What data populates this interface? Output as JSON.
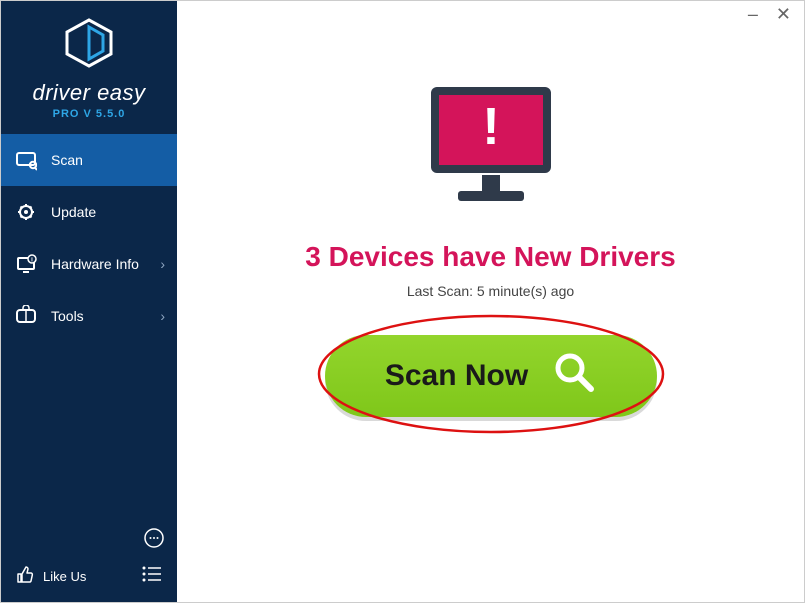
{
  "window": {
    "minimize": "–",
    "close": "✕"
  },
  "brand": {
    "name": "driver easy",
    "subtitle": "PRO V 5.5.0"
  },
  "sidebar": {
    "items": [
      {
        "label": "Scan",
        "icon": "scan-icon",
        "active": true,
        "hasSubmenu": false
      },
      {
        "label": "Update",
        "icon": "update-icon",
        "active": false,
        "hasSubmenu": false
      },
      {
        "label": "Hardware Info",
        "icon": "hardware-info-icon",
        "active": false,
        "hasSubmenu": true
      },
      {
        "label": "Tools",
        "icon": "tools-icon",
        "active": false,
        "hasSubmenu": true
      }
    ],
    "likeUs": "Like Us"
  },
  "main": {
    "headline": "3 Devices have New Drivers",
    "lastScan": "Last Scan: 5 minute(s) ago",
    "scanButton": "Scan Now"
  },
  "colors": {
    "sidebarBg": "#0b2749",
    "activeBg": "#145da5",
    "accentPink": "#d4145a",
    "buttonGreen": "#8bd022",
    "brandBlue": "#2ea6e6"
  }
}
